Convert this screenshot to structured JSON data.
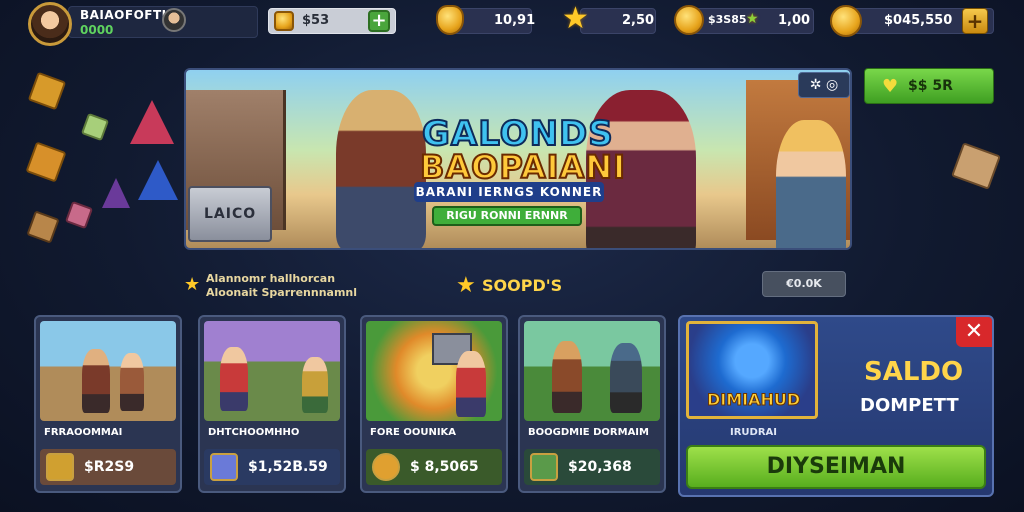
{
  "player": {
    "name": "BAIAOFOFTIN",
    "level": "0000"
  },
  "currencies": [
    {
      "value": "$53",
      "icon": "coin-icon"
    },
    {
      "value": "10,91",
      "icon": "shield-icon"
    },
    {
      "value": "2,50",
      "icon": "star-icon"
    },
    {
      "value": "$3S85",
      "extra": "1,00",
      "icon": "coin-icon"
    },
    {
      "value": "$045,550",
      "icon": "coin-icon"
    }
  ],
  "banner": {
    "crate_label": "LAICO",
    "logo_line1": "GALONDS",
    "logo_line2": "BAOPAIANI",
    "logo_line3": "BARANI IERNGS KONNER",
    "logo_line4": "RIGU RONNI ERNNR"
  },
  "buy_button": {
    "label": "$$ 5R"
  },
  "promo": {
    "line1": "Alannomr hallhorcan",
    "line2": "Aloonait Sparrennnamnl"
  },
  "section": {
    "title": "SOOPD'S",
    "ok_label": "€0.0K"
  },
  "cards": [
    {
      "title": "FRRAOOMMAI",
      "price": "$R2S9"
    },
    {
      "title": "DHTCHOOMHHO",
      "price": "$1,52B.59"
    },
    {
      "title": "FORE OOUNIKA",
      "price": "$ 8,5065"
    },
    {
      "title": "BOOGDMIE DORMAIM",
      "price": "$20,368"
    }
  ],
  "saldo": {
    "title": "SALDO",
    "subtitle": "DOMPETT",
    "art_label": "DIMIAHUD",
    "small": "IRUDRAI",
    "button": "DIYSEIMAN",
    "close": "✕"
  }
}
